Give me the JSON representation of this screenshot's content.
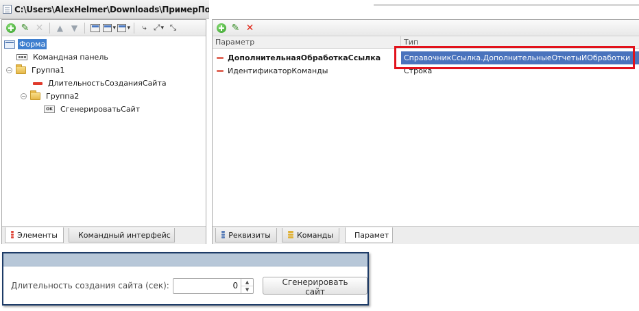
{
  "editor": {
    "title_path": "C:\\Users\\AlexHelmer\\Downloads\\ПримерПодкл",
    "left_panel": {
      "tree": [
        {
          "label": "Форма",
          "icon": "form-icon",
          "level": 0,
          "selected": true
        },
        {
          "label": "Командная панель",
          "icon": "command-panel-icon",
          "level": 1
        },
        {
          "label": "Группа1",
          "icon": "folder-icon",
          "level": 0,
          "expanded": true
        },
        {
          "label": "ДлительностьСозданияСайта",
          "icon": "attribute-icon",
          "level": 2
        },
        {
          "label": "Группа2",
          "icon": "folder-icon",
          "level": 1,
          "expanded": true
        },
        {
          "label": "СгенерироватьСайт",
          "icon": "ok-button-icon",
          "level": 3
        }
      ],
      "tabs": {
        "elements": "Элементы",
        "command_interface": "Командный интерфейс"
      }
    },
    "right_panel": {
      "columns": {
        "param": "Параметр",
        "type": "Тип"
      },
      "rows": [
        {
          "param": "ДополнительнаяОбработкаСсылка",
          "type": "СправочникСсылка.ДополнительныеОтчетыИОбработки",
          "bold": true,
          "selected": true
        },
        {
          "param": "ИдентификаторКоманды",
          "type": "Строка",
          "bold": false,
          "selected": false
        }
      ],
      "tabs": {
        "attributes": "Реквизиты",
        "commands": "Команды",
        "parameters": "Парамет"
      }
    }
  },
  "form": {
    "field_label": "Длительность создания сайта (сек):",
    "field_value": "0",
    "generate_button": "Сгенерировать сайт"
  },
  "colors": {
    "selection": "#3f7fcf",
    "highlight_frame": "#e2121b",
    "form_header": "#b7c7d8"
  }
}
